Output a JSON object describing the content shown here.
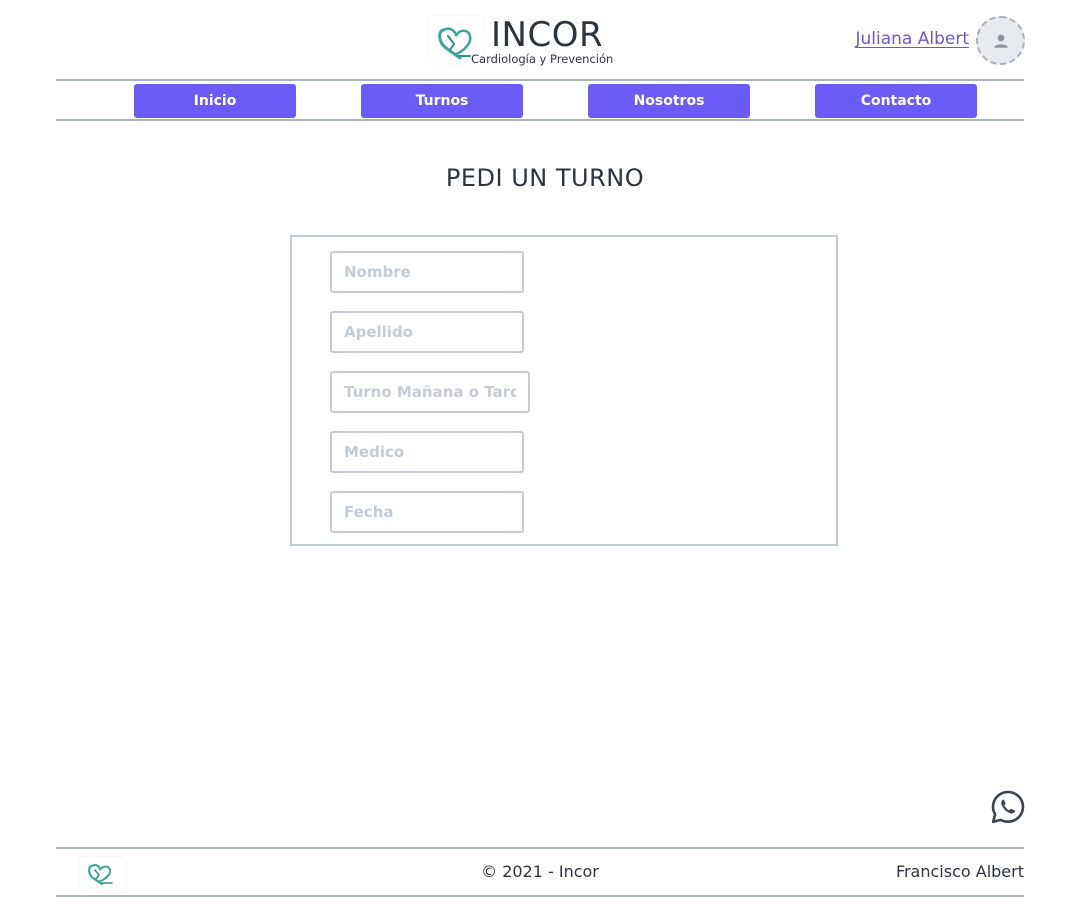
{
  "header": {
    "brand_name": "INCOR",
    "brand_subtitle": "Cardiología y Prevención",
    "user_name": "Juliana Albert",
    "logo_icon": "heart-stethoscope-logo",
    "avatar_icon": "user-icon"
  },
  "nav": {
    "items": [
      {
        "label": "Inicio"
      },
      {
        "label": "Turnos"
      },
      {
        "label": "Nosotros"
      },
      {
        "label": "Contacto"
      }
    ]
  },
  "main": {
    "title": "PEDI UN TURNO",
    "form": {
      "nombre_placeholder": "Nombre",
      "apellido_placeholder": "Apellido",
      "turno_placeholder": "Turno Mañana o Tarde",
      "medico_placeholder": "Medico",
      "fecha_placeholder": "Fecha"
    },
    "whatsapp_icon": "whatsapp-icon"
  },
  "footer": {
    "copyright": "© 2021 - Incor",
    "author": "Francisco Albert"
  },
  "colors": {
    "accent": "#6b5bf7",
    "link": "#6a5acd",
    "logo_teal": "#3aa79a",
    "border": "#a9b3bd",
    "text": "#2c3440"
  }
}
